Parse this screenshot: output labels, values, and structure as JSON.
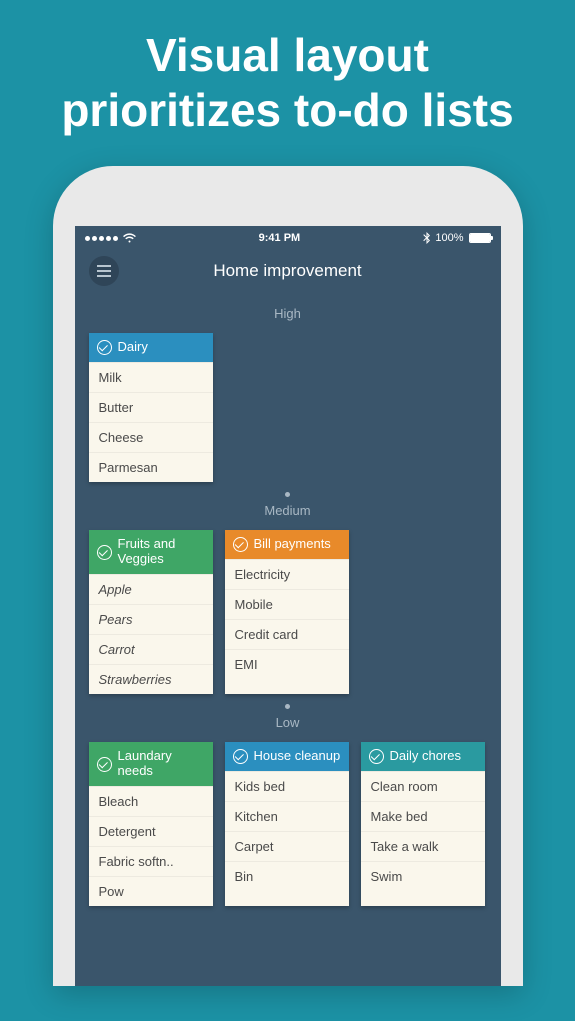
{
  "promo": {
    "line1": "Visual layout",
    "line2": "prioritizes to-do lists"
  },
  "statusbar": {
    "time": "9:41 PM",
    "battery": "100%"
  },
  "navbar": {
    "title": "Home improvement"
  },
  "sections": {
    "high": {
      "label": "High",
      "cards": [
        {
          "title": "Dairy",
          "items": [
            "Milk",
            "Butter",
            "Cheese",
            "Parmesan"
          ]
        }
      ]
    },
    "medium": {
      "label": "Medium",
      "cards": [
        {
          "title": "Fruits and Veggies",
          "items": [
            "Apple",
            "Pears",
            "Carrot",
            "Strawberries"
          ]
        },
        {
          "title": "Bill payments",
          "items": [
            "Electricity",
            "Mobile",
            "Credit card",
            "EMI"
          ]
        }
      ]
    },
    "low": {
      "label": "Low",
      "cards": [
        {
          "title": "Laundary needs",
          "items": [
            "Bleach",
            "Detergent",
            "Fabric softn..",
            "Pow"
          ]
        },
        {
          "title": "House cleanup",
          "items": [
            "Kids bed",
            "Kitchen",
            "Carpet",
            "Bin"
          ]
        },
        {
          "title": "Daily chores",
          "items": [
            "Clean room",
            "Make bed",
            "Take a walk",
            "Swim"
          ]
        }
      ]
    }
  }
}
